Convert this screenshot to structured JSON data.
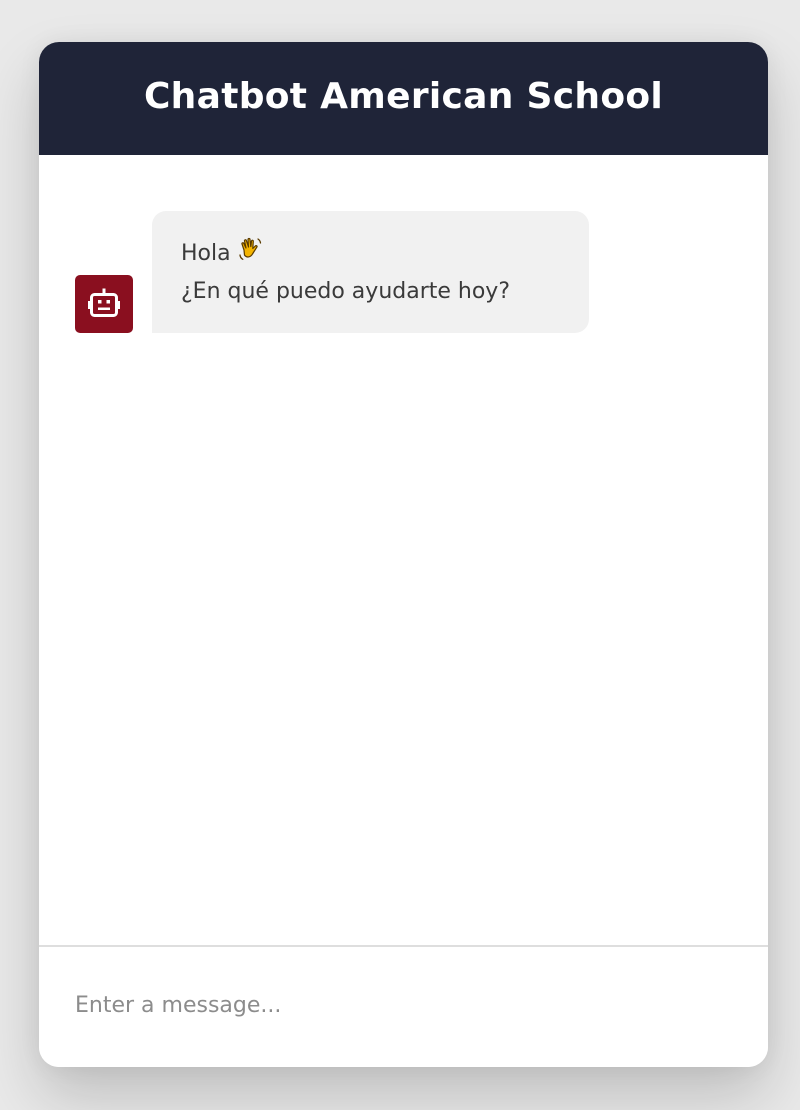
{
  "header": {
    "title": "Chatbot American School"
  },
  "messages": [
    {
      "sender": "bot",
      "avatar_icon": "robot-icon",
      "lines": [
        "Hola",
        "¿En qué puedo ayudarte hoy?"
      ],
      "emoji_icon": "waving-hand-icon"
    }
  ],
  "input": {
    "value": "",
    "placeholder": "Enter a message..."
  },
  "colors": {
    "header_bg": "#1f2438",
    "avatar_bg": "#8a0f1f",
    "bubble_bg": "#f1f1f1",
    "page_bg": "#e9e9e9"
  }
}
